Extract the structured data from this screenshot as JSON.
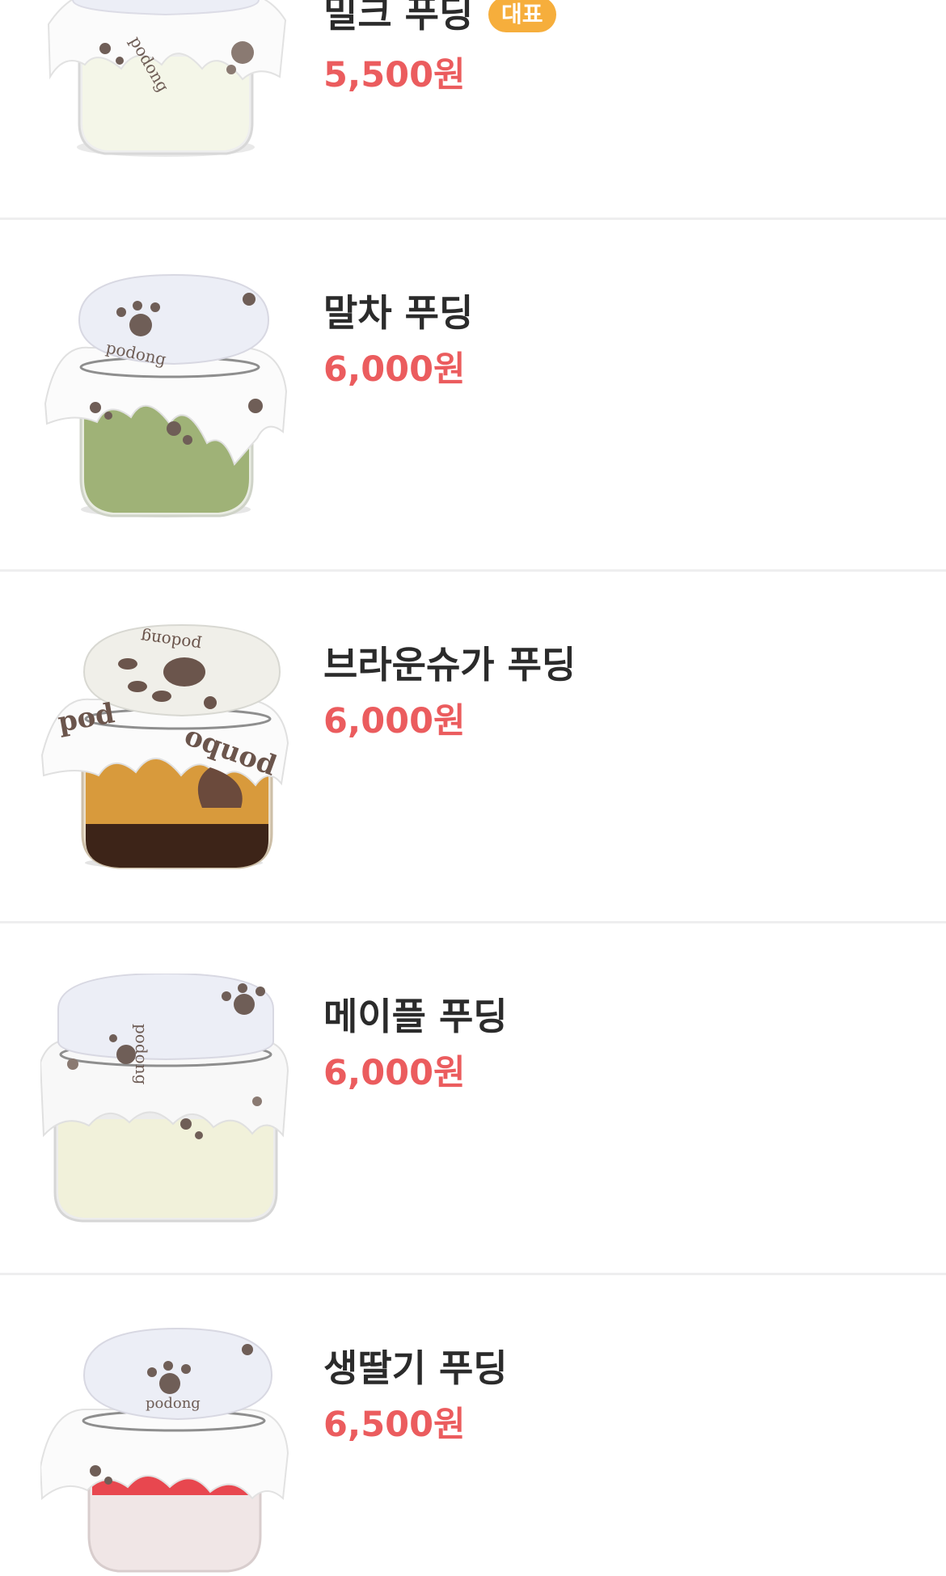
{
  "menu": {
    "items": [
      {
        "name": "밀크 푸딩",
        "price": "5,500원",
        "badge": "대표",
        "flavor": "milk"
      },
      {
        "name": "말차 푸딩",
        "price": "6,000원",
        "flavor": "matcha"
      },
      {
        "name": "브라운슈가 푸딩",
        "price": "6,000원",
        "flavor": "brown-sugar"
      },
      {
        "name": "메이플 푸딩",
        "price": "6,000원",
        "flavor": "maple"
      },
      {
        "name": "생딸기 푸딩",
        "price": "6,500원",
        "flavor": "strawberry"
      }
    ]
  },
  "colors": {
    "price": "#eb5c5e",
    "badge": "#f6ae3c",
    "name": "#2b2b2b",
    "divider": "#eeeeef"
  },
  "jar": {
    "lid_text": "podong",
    "colors": {
      "milk": "#f4f6e8",
      "matcha": "#9fb277",
      "brown-sugar": "#d89a3c",
      "maple": "#f1f1da",
      "strawberry": "#e8474f"
    }
  }
}
